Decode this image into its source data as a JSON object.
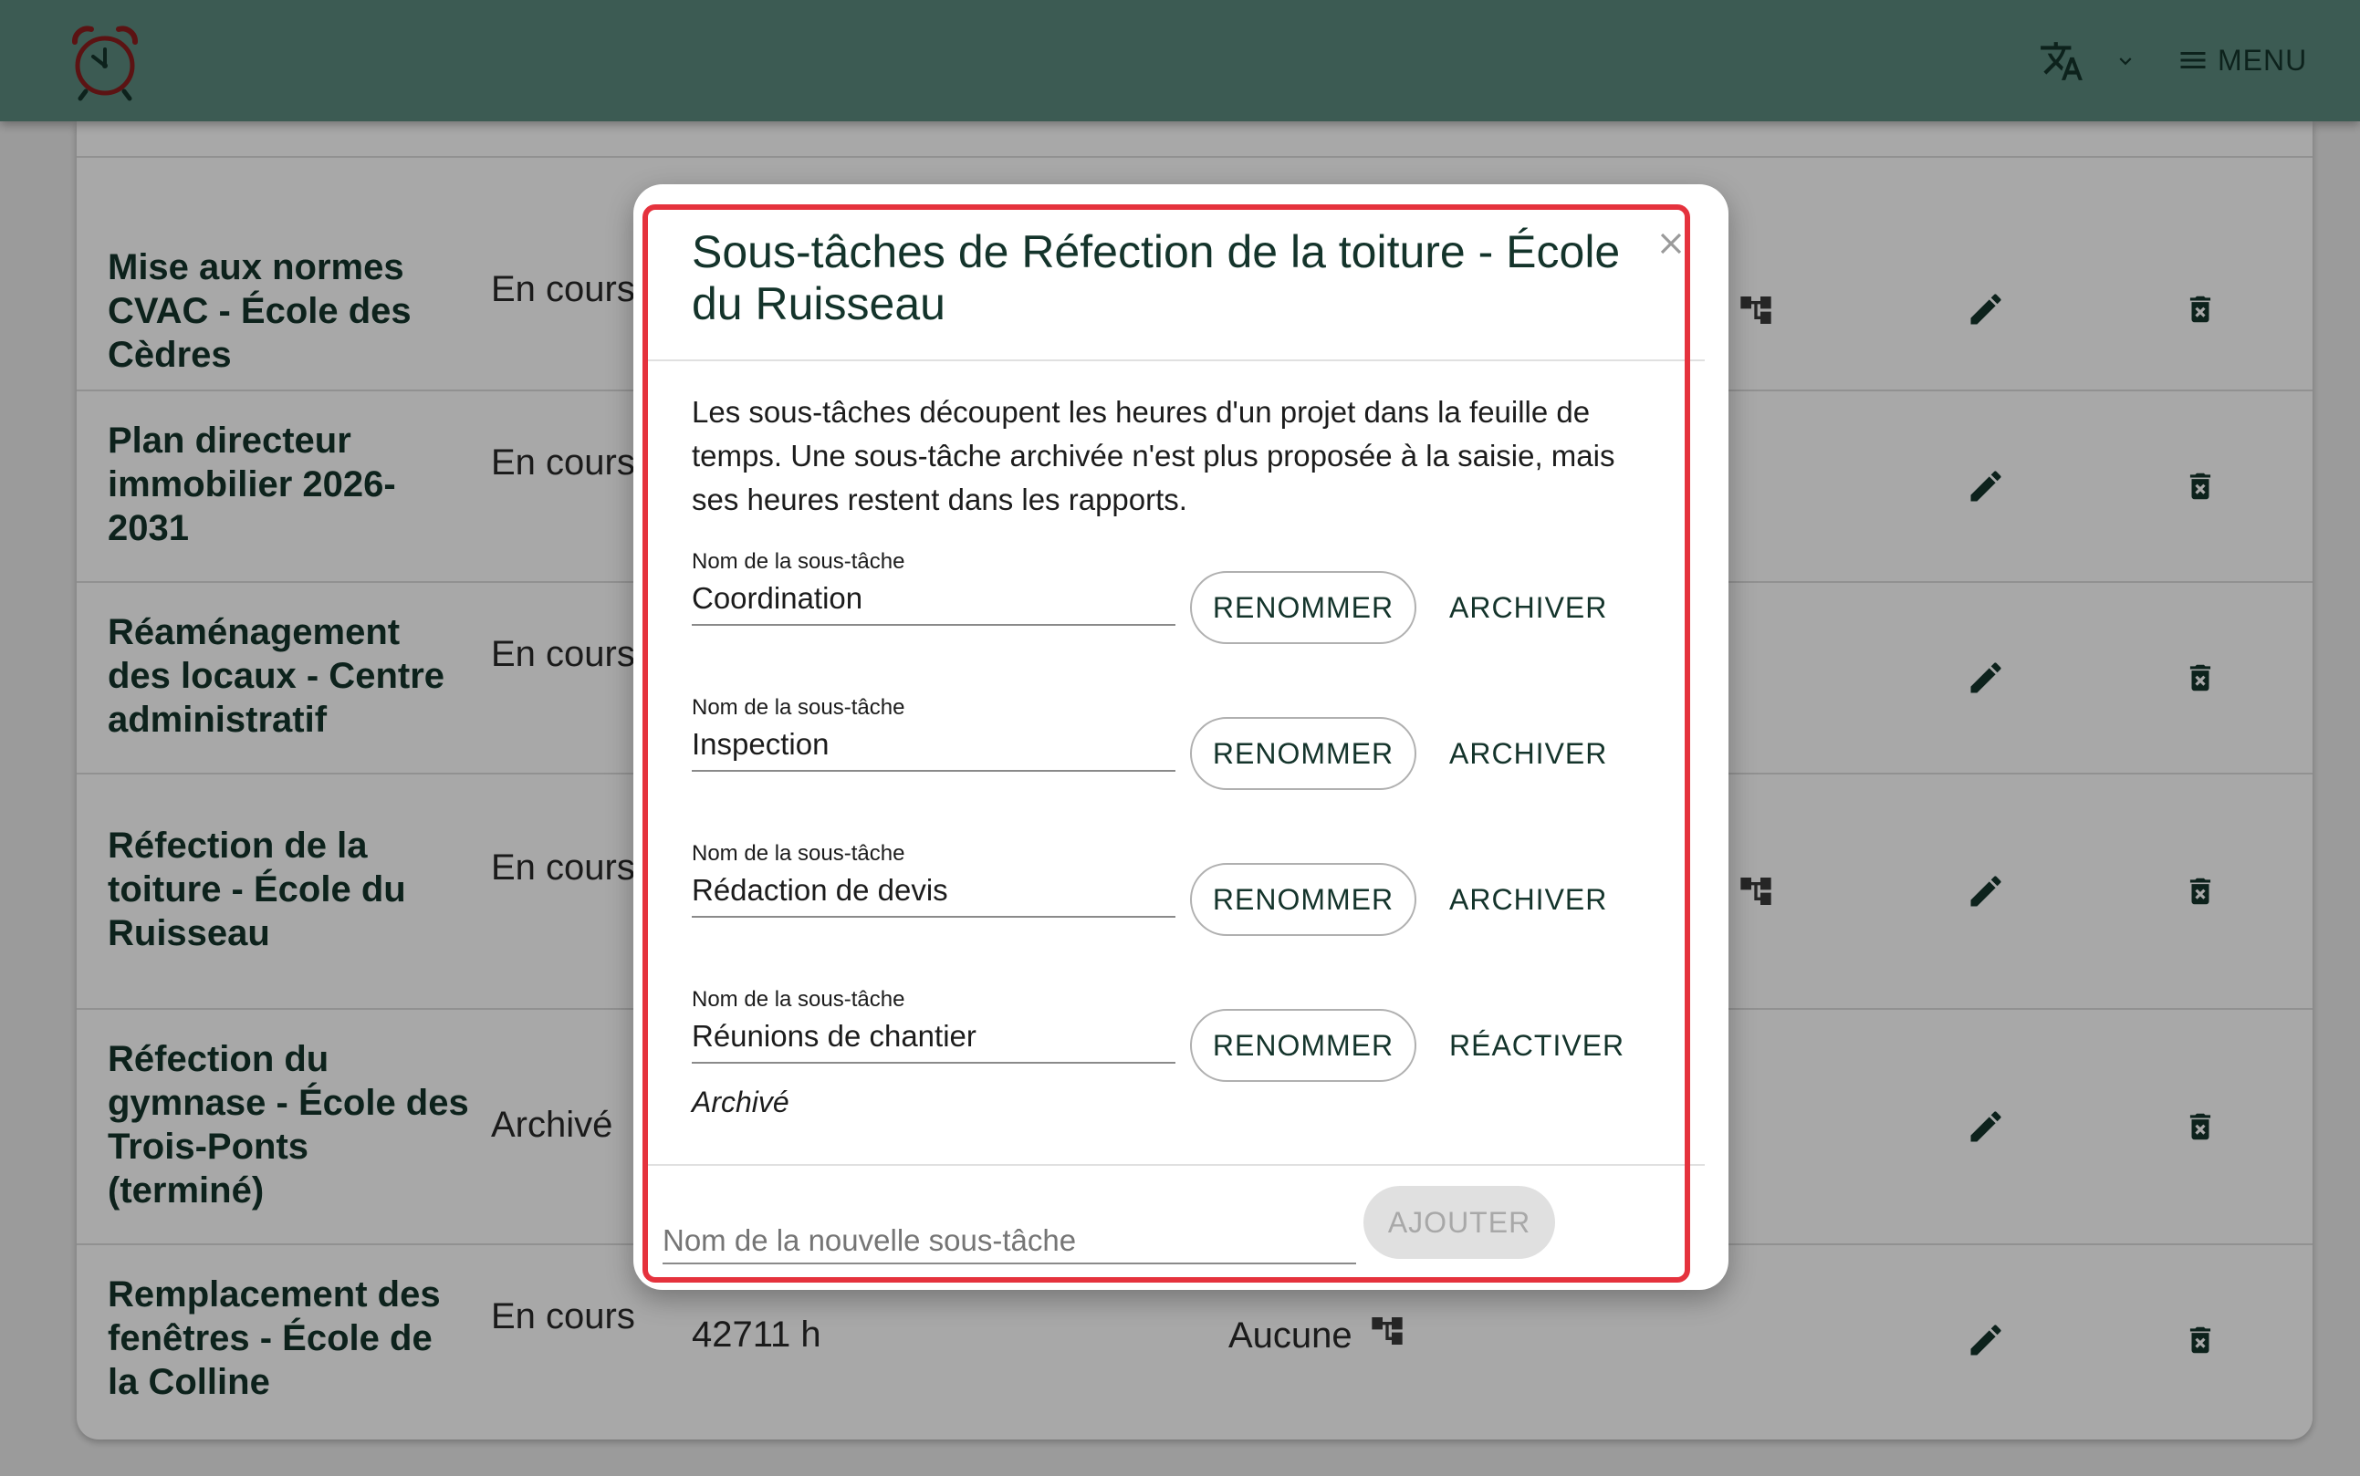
{
  "header": {
    "logo_icon": "alarm-clock-icon",
    "language_icon": "translate-icon",
    "language_chevron_icon": "chevron-down-icon",
    "menu_icon": "hamburger-icon",
    "menu_label": "MENU"
  },
  "projects": [
    {
      "name": "Mise aux normes CVAC - École des Cèdres",
      "status": "En cours",
      "has_subtasks": true
    },
    {
      "name": "Plan directeur immobilier 2026-2031",
      "status": "En cours",
      "has_subtasks": false
    },
    {
      "name": "Réaménagement des locaux - Centre administratif",
      "status": "En cours",
      "has_subtasks": false
    },
    {
      "name": "Réfection de la toiture - École du Ruisseau",
      "status": "En cours",
      "has_subtasks": true
    },
    {
      "name": "Réfection du gymnase - École des Trois-Ponts (terminé)",
      "status": "Archivé",
      "has_subtasks": false
    },
    {
      "name": "Remplacement des fenêtres - École de la Colline",
      "status": "En cours",
      "hours": "42711 h",
      "subtasks": "Aucune",
      "has_subtasks": true
    }
  ],
  "dialog": {
    "title": "Sous-tâches de Réfection de la toiture - École du Ruisseau",
    "close_icon": "close-icon",
    "intro": "Les sous-tâches découpent les heures d'un projet dans la feuille de temps. Une sous-tâche archivée n'est plus proposée à la saisie, mais ses heures restent dans les rapports.",
    "field_label": "Nom de la sous-tâche",
    "rename_label": "RENOMMER",
    "subtasks": [
      {
        "name": "Coordination",
        "action": "ARCHIVER",
        "archived": false
      },
      {
        "name": "Inspection",
        "action": "ARCHIVER",
        "archived": false
      },
      {
        "name": "Rédaction de devis",
        "action": "ARCHIVER",
        "archived": false
      },
      {
        "name": "Réunions de chantier",
        "action": "RÉACTIVER",
        "archived": true,
        "archived_note": "Archivé"
      }
    ],
    "new_subtask_placeholder": "Nom de la nouvelle sous-tâche",
    "add_label": "AJOUTER",
    "highlight_color": "#e5323d"
  },
  "colors": {
    "appbar": "#5b8a7e",
    "text_primary": "#14342b"
  }
}
